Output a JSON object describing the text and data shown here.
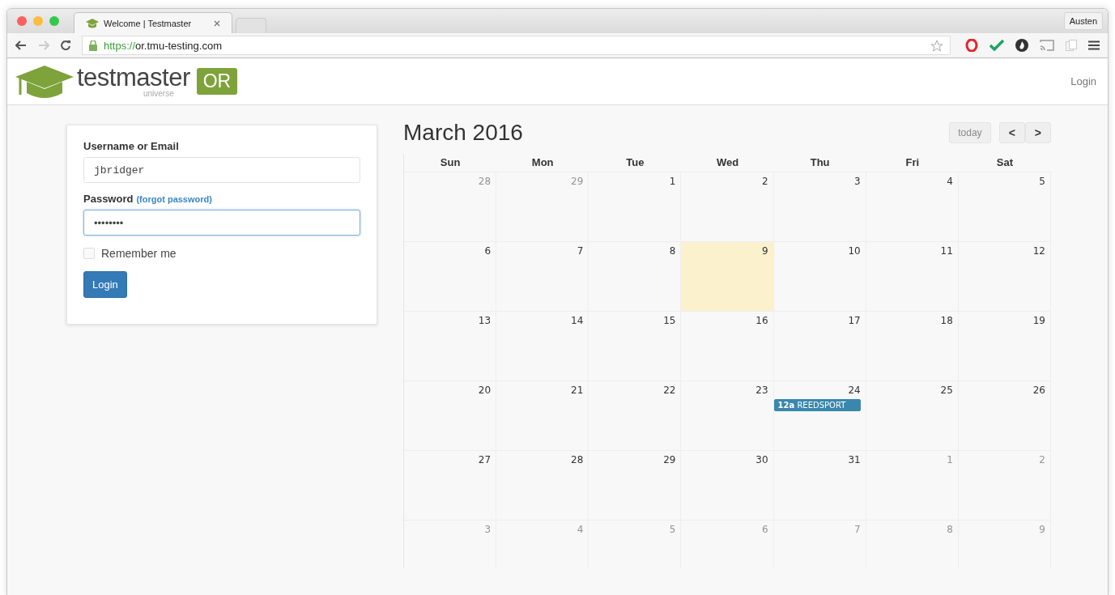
{
  "browser": {
    "tab_title": "Welcome | Testmaster",
    "profile": "Austen",
    "url_scheme": "https://",
    "url_rest": "or.tmu-testing.com"
  },
  "header": {
    "logo_word": "testmaster",
    "logo_sub": "universe",
    "logo_badge": "OR",
    "login_link": "Login"
  },
  "login_form": {
    "username_label": "Username or Email",
    "username_value": "jbridger",
    "password_label": "Password",
    "forgot_link": "(forgot password)",
    "password_value": "••••••••",
    "remember_label": "Remember me",
    "remember_checked": false,
    "submit": "Login"
  },
  "calendar": {
    "title": "March 2016",
    "today_button": "today",
    "prev": "<",
    "next": ">",
    "weekdays": [
      "Sun",
      "Mon",
      "Tue",
      "Wed",
      "Thu",
      "Fri",
      "Sat"
    ],
    "weeks": [
      [
        {
          "label": "28",
          "other_month": true,
          "today": false
        },
        {
          "label": "29",
          "other_month": true,
          "today": false
        },
        {
          "label": "1",
          "other_month": false,
          "today": false
        },
        {
          "label": "2",
          "other_month": false,
          "today": false
        },
        {
          "label": "3",
          "other_month": false,
          "today": false
        },
        {
          "label": "4",
          "other_month": false,
          "today": false
        },
        {
          "label": "5",
          "other_month": false,
          "today": false
        }
      ],
      [
        {
          "label": "6",
          "other_month": false,
          "today": false
        },
        {
          "label": "7",
          "other_month": false,
          "today": false
        },
        {
          "label": "8",
          "other_month": false,
          "today": false
        },
        {
          "label": "9",
          "other_month": false,
          "today": true
        },
        {
          "label": "10",
          "other_month": false,
          "today": false
        },
        {
          "label": "11",
          "other_month": false,
          "today": false
        },
        {
          "label": "12",
          "other_month": false,
          "today": false
        }
      ],
      [
        {
          "label": "13",
          "other_month": false,
          "today": false
        },
        {
          "label": "14",
          "other_month": false,
          "today": false
        },
        {
          "label": "15",
          "other_month": false,
          "today": false
        },
        {
          "label": "16",
          "other_month": false,
          "today": false
        },
        {
          "label": "17",
          "other_month": false,
          "today": false
        },
        {
          "label": "18",
          "other_month": false,
          "today": false
        },
        {
          "label": "19",
          "other_month": false,
          "today": false
        }
      ],
      [
        {
          "label": "20",
          "other_month": false,
          "today": false
        },
        {
          "label": "21",
          "other_month": false,
          "today": false
        },
        {
          "label": "22",
          "other_month": false,
          "today": false
        },
        {
          "label": "23",
          "other_month": false,
          "today": false
        },
        {
          "label": "24",
          "other_month": false,
          "today": false,
          "events": [
            {
              "time": "12a",
              "title": "REEDSPORT"
            }
          ]
        },
        {
          "label": "25",
          "other_month": false,
          "today": false
        },
        {
          "label": "26",
          "other_month": false,
          "today": false
        }
      ],
      [
        {
          "label": "27",
          "other_month": false,
          "today": false
        },
        {
          "label": "28",
          "other_month": false,
          "today": false
        },
        {
          "label": "29",
          "other_month": false,
          "today": false
        },
        {
          "label": "30",
          "other_month": false,
          "today": false
        },
        {
          "label": "31",
          "other_month": false,
          "today": false
        },
        {
          "label": "1",
          "other_month": true,
          "today": false
        },
        {
          "label": "2",
          "other_month": true,
          "today": false
        }
      ],
      [
        {
          "label": "3",
          "other_month": true,
          "today": false
        },
        {
          "label": "4",
          "other_month": true,
          "today": false
        },
        {
          "label": "5",
          "other_month": true,
          "today": false
        },
        {
          "label": "6",
          "other_month": true,
          "today": false
        },
        {
          "label": "7",
          "other_month": true,
          "today": false
        },
        {
          "label": "8",
          "other_month": true,
          "today": false
        },
        {
          "label": "9",
          "other_month": true,
          "today": false
        }
      ]
    ]
  }
}
